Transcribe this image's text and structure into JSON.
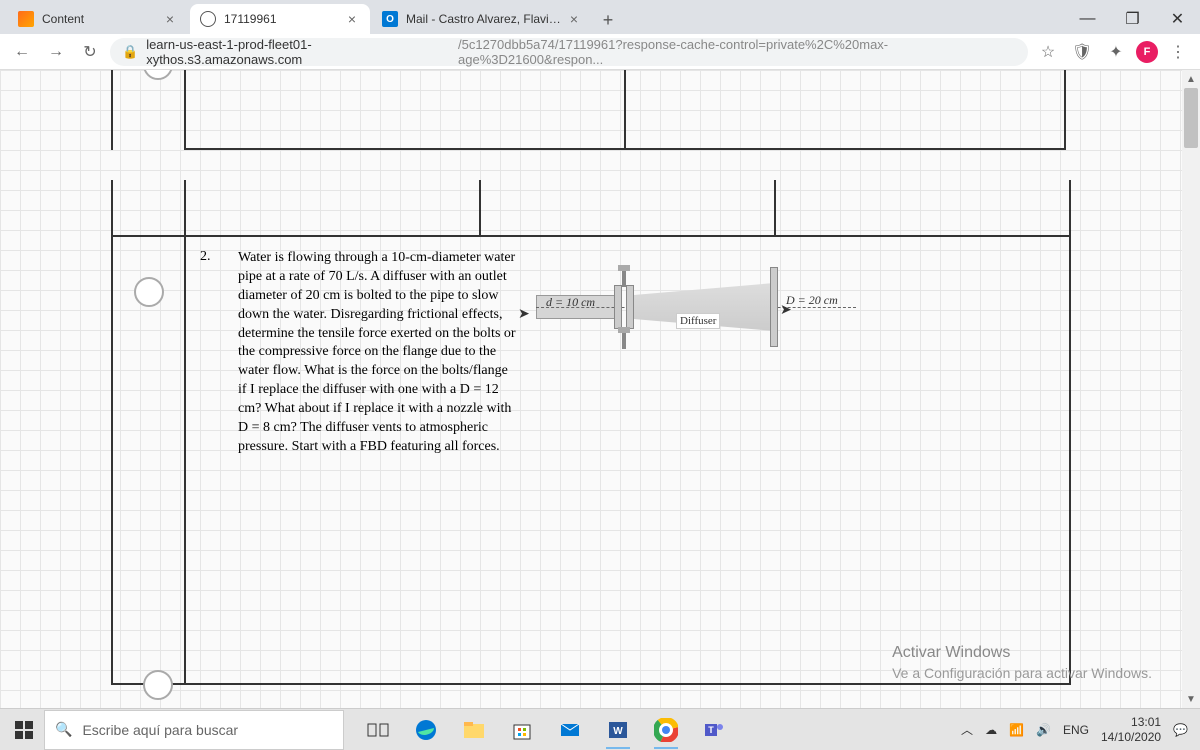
{
  "window": {
    "minimize_tip": "—",
    "maximize_tip": "❐",
    "close_tip": "✕"
  },
  "tabs": [
    {
      "title": "Content",
      "icon": "content",
      "active": false
    },
    {
      "title": "17119961",
      "icon": "globe",
      "active": true
    },
    {
      "title": "Mail - Castro Alvarez, Flavio - Ou",
      "icon": "mail",
      "active": false
    }
  ],
  "new_tab_label": "+",
  "address": {
    "domain": "learn-us-east-1-prod-fleet01-xythos.s3.amazonaws.com",
    "path": "/5c1270dbb5a74/17119961?response-cache-control=private%2C%20max-age%3D21600&respon..."
  },
  "profile_initial": "F",
  "problem": {
    "number": "2.",
    "text": "Water is flowing through a 10-cm-diameter water pipe at a rate of 70 L/s. A diffuser with an outlet diameter of 20 cm is bolted to the pipe to slow down the water. Disregarding frictional effects, determine the tensile force exerted on the bolts or the compressive force on the flange due to the water flow. What is the force on the bolts/flange if I replace the diffuser with one with a D = 12 cm? What about if I replace it with a nozzle with D = 8 cm? The diffuser vents to atmospheric pressure. Start with a FBD featuring all forces."
  },
  "diagram": {
    "d_label": "d = 10 cm",
    "D_label": "D = 20 cm",
    "diffuser_label": "Diffuser"
  },
  "watermark": {
    "title": "Activar Windows",
    "sub": "Ve a Configuración para activar Windows."
  },
  "taskbar": {
    "search_placeholder": "Escribe aquí para buscar",
    "lang": "ENG",
    "time": "13:01",
    "date": "14/10/2020"
  }
}
